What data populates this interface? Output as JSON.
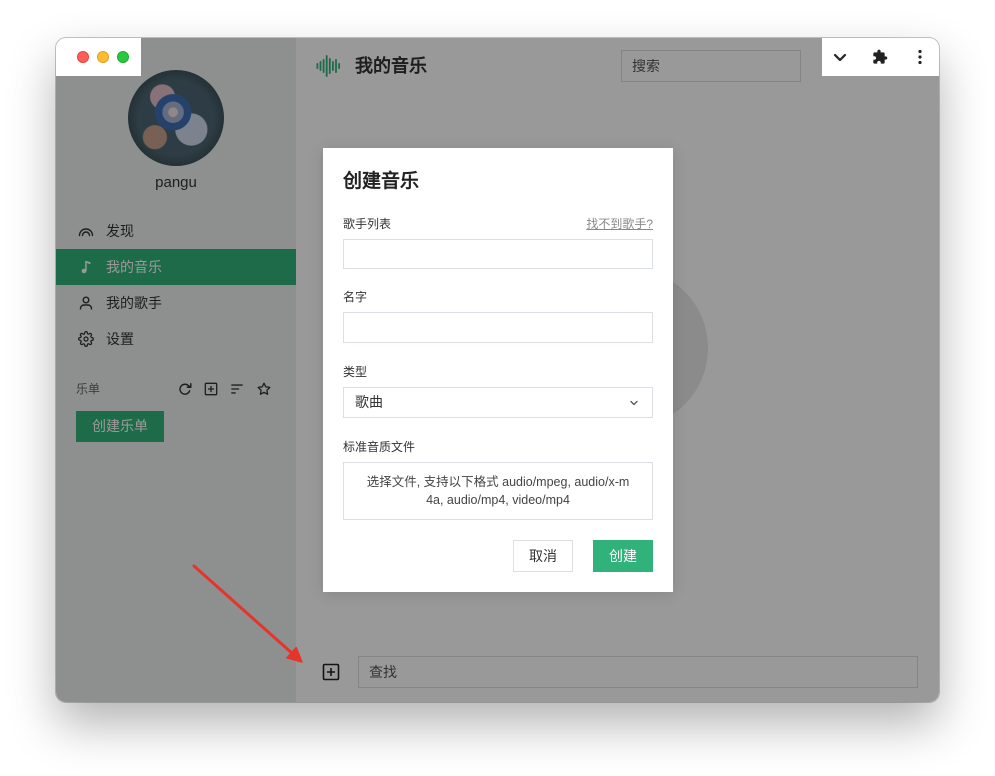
{
  "colors": {
    "accent": "#31b27a",
    "sidebar_bg": "#ecf1ee",
    "overlay": "rgba(0,0,0,0.4)",
    "annotation_arrow": "#e5352b",
    "traffic_close": "#ff5f57",
    "traffic_minimize": "#febc2e",
    "traffic_maximize": "#28c840"
  },
  "window_toolbar": {
    "icons": [
      "chevron-down-icon",
      "puzzle-icon",
      "more-vertical-icon"
    ]
  },
  "sidebar": {
    "username": "pangu",
    "nav": [
      {
        "label": "发现",
        "icon": "discover-icon",
        "active": false
      },
      {
        "label": "我的音乐",
        "icon": "music-note-icon",
        "active": true
      },
      {
        "label": "我的歌手",
        "icon": "user-icon",
        "active": false
      },
      {
        "label": "设置",
        "icon": "gear-icon",
        "active": false
      }
    ],
    "playlists": {
      "label": "乐单",
      "action_icons": [
        "refresh-icon",
        "plus-square-icon",
        "sort-icon",
        "star-icon"
      ],
      "create_button_label": "创建乐单"
    }
  },
  "header": {
    "logo_icon": "waveform-icon",
    "title": "我的音乐",
    "search_placeholder": "搜索"
  },
  "footer": {
    "add_icon": "plus-square-icon",
    "find_placeholder": "查找"
  },
  "modal": {
    "title": "创建音乐",
    "singer_list": {
      "label": "歌手列表",
      "help_link": "找不到歌手?",
      "value": ""
    },
    "name": {
      "label": "名字",
      "value": ""
    },
    "type": {
      "label": "类型",
      "selected": "歌曲"
    },
    "audio_file": {
      "label": "标准音质文件",
      "hint": "选择文件, 支持以下格式 audio/mpeg, audio/x-m4a, audio/mp4, video/mp4"
    },
    "cancel_label": "取消",
    "submit_label": "创建"
  }
}
